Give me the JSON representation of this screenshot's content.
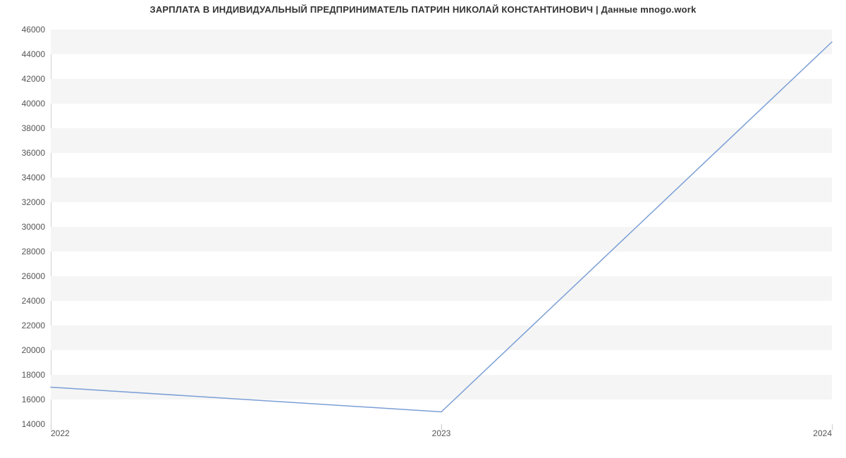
{
  "chart_data": {
    "type": "line",
    "title": "ЗАРПЛАТА В ИНДИВИДУАЛЬНЫЙ ПРЕДПРИНИМАТЕЛЬ ПАТРИН НИКОЛАЙ КОНСТАНТИНОВИЧ | Данные mnogo.work",
    "x": [
      2022,
      2023,
      2024
    ],
    "values": [
      17000,
      15000,
      45000
    ],
    "xlabel": "",
    "ylabel": "",
    "xlim": [
      2022,
      2024
    ],
    "ylim": [
      14000,
      46000
    ],
    "y_ticks": [
      14000,
      16000,
      18000,
      20000,
      22000,
      24000,
      26000,
      28000,
      30000,
      32000,
      34000,
      36000,
      38000,
      40000,
      42000,
      44000,
      46000
    ],
    "x_ticks": [
      2022,
      2023,
      2024
    ],
    "line_color": "#7b9fd6",
    "grid": true
  }
}
